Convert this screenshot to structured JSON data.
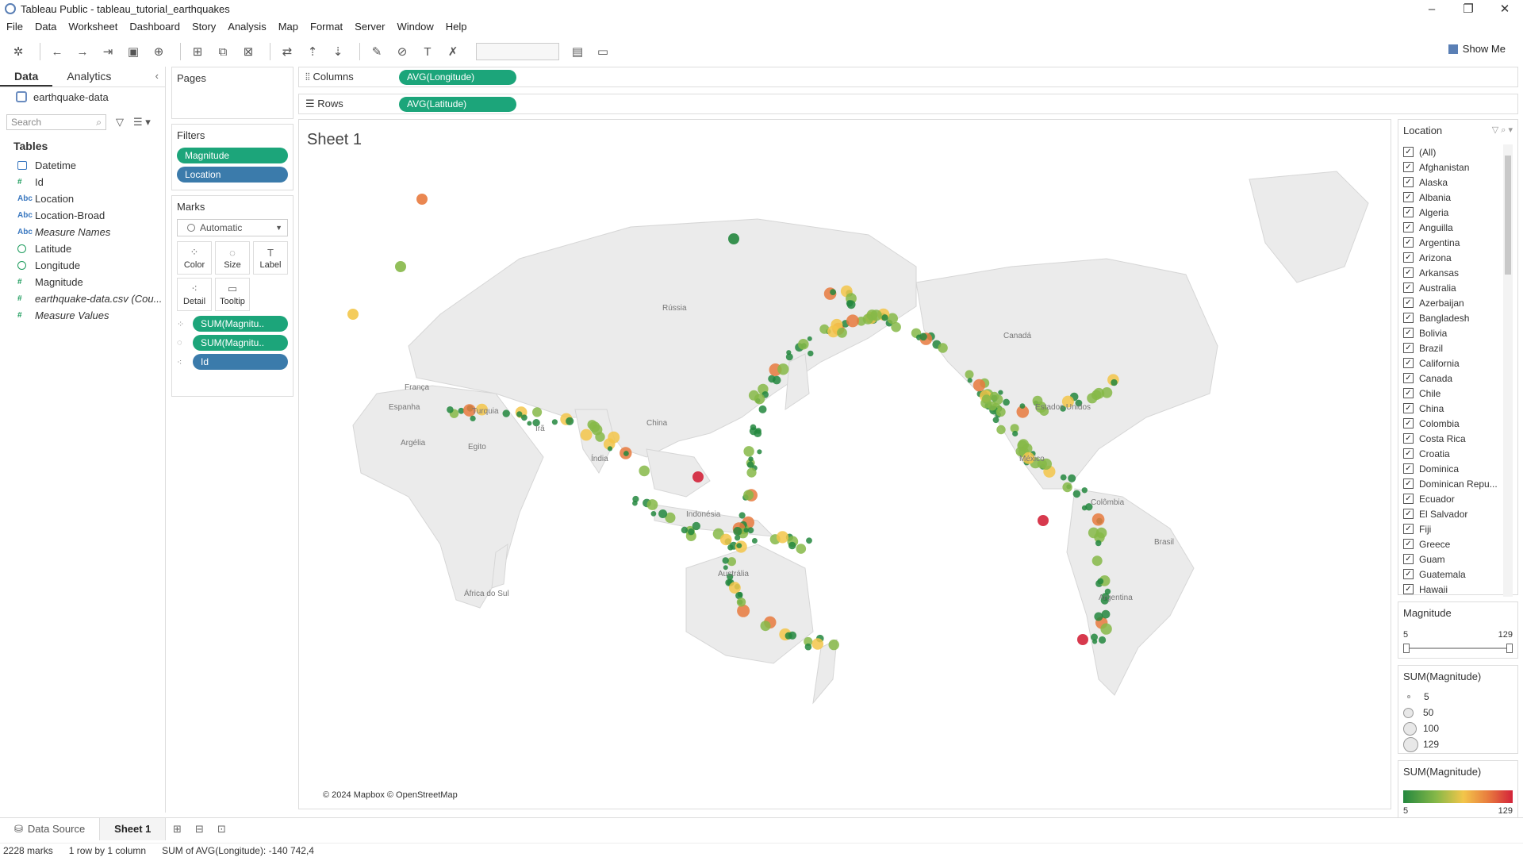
{
  "window": {
    "title": "Tableau Public - tableau_tutorial_earthquakes"
  },
  "menu": [
    "File",
    "Data",
    "Worksheet",
    "Dashboard",
    "Story",
    "Analysis",
    "Map",
    "Format",
    "Server",
    "Window",
    "Help"
  ],
  "toolbar": {
    "show_me": "Show Me"
  },
  "data_pane": {
    "tabs": [
      "Data",
      "Analytics"
    ],
    "datasource": "earthquake-data",
    "search_placeholder": "Search",
    "tables_header": "Tables",
    "fields": [
      {
        "name": "Datetime",
        "type": "date"
      },
      {
        "name": "Id",
        "type": "measure"
      },
      {
        "name": "Location",
        "type": "abc"
      },
      {
        "name": "Location-Broad",
        "type": "abc"
      },
      {
        "name": "Measure Names",
        "type": "abc",
        "italic": true
      },
      {
        "name": "Latitude",
        "type": "geo"
      },
      {
        "name": "Longitude",
        "type": "geo"
      },
      {
        "name": "Magnitude",
        "type": "measure"
      },
      {
        "name": "earthquake-data.csv (Cou...",
        "type": "measure",
        "italic": true
      },
      {
        "name": "Measure Values",
        "type": "measure",
        "italic": true
      }
    ]
  },
  "pages": {
    "header": "Pages"
  },
  "filters": {
    "header": "Filters",
    "items": [
      "Magnitude",
      "Location"
    ]
  },
  "marks": {
    "header": "Marks",
    "type": "Automatic",
    "buttons": [
      "Color",
      "Size",
      "Label",
      "Detail",
      "Tooltip"
    ],
    "pills": [
      "SUM(Magnitu..",
      "SUM(Magnitu..",
      "Id"
    ]
  },
  "shelves": {
    "columns_label": "Columns",
    "columns_pill": "AVG(Longitude)",
    "rows_label": "Rows",
    "rows_pill": "AVG(Latitude)"
  },
  "sheet": {
    "title": "Sheet 1",
    "copyright": "© 2024 Mapbox © OpenStreetMap"
  },
  "map_labels": [
    "Rússia",
    "Canadá",
    "França",
    "Espanha",
    "Argélia",
    "Egito",
    "Turquia",
    "Irã",
    "Índia",
    "China",
    "Indonésia",
    "Austrália",
    "Estados Unidos",
    "México",
    "Colômbia",
    "Brasil",
    "Argentina",
    "África do Sul"
  ],
  "location_filter": {
    "header": "Location",
    "items": [
      "(All)",
      "Afghanistan",
      "Alaska",
      "Albania",
      "Algeria",
      "Anguilla",
      "Argentina",
      "Arizona",
      "Arkansas",
      "Australia",
      "Azerbaijan",
      "Bangladesh",
      "Bolivia",
      "Brazil",
      "California",
      "Canada",
      "Chile",
      "China",
      "Colombia",
      "Costa Rica",
      "Croatia",
      "Dominica",
      "Dominican Repu...",
      "Ecuador",
      "El Salvador",
      "Fiji",
      "Greece",
      "Guam",
      "Guatemala",
      "Hawaii"
    ]
  },
  "magnitude_filter": {
    "header": "Magnitude",
    "min": "5",
    "max": "129"
  },
  "size_legend": {
    "header": "SUM(Magnitude)",
    "items": [
      "5",
      "50",
      "100",
      "129"
    ]
  },
  "color_legend": {
    "header": "SUM(Magnitude)",
    "min": "5",
    "max": "129",
    "colors": [
      "#23873e",
      "#86b848",
      "#f3c64a",
      "#e87a3e",
      "#d3233a"
    ]
  },
  "sheet_tabs": [
    "Data Source",
    "Sheet 1"
  ],
  "status": {
    "marks": "2228 marks",
    "dims": "1 row by 1 column",
    "sum": "SUM of AVG(Longitude): -140 742,4"
  }
}
